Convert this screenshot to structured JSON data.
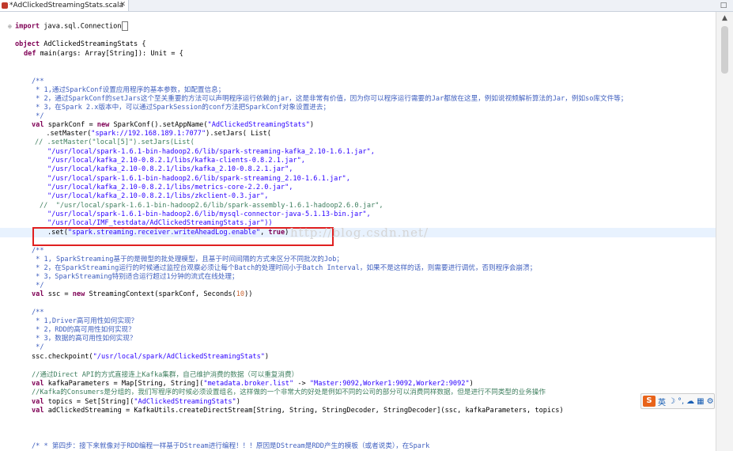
{
  "tab": {
    "title": "*AdClickedStreamingStats.scala",
    "close": "✕"
  },
  "window": {
    "maximize": "□"
  },
  "scrollbar": {
    "up": "▲"
  },
  "watermark": "http://blog.csdn.net/",
  "ime": {
    "logo": "S",
    "lang": "英",
    "icons": [
      "☽",
      "°,",
      "☁",
      "▦",
      "⚙"
    ]
  },
  "code": {
    "import_kw": "import",
    "import_rest": " java.sql.Connection",
    "object_kw": "object",
    "object_rest": " AdClickedStreamingStats {",
    "def_kw": "def",
    "def_rest": " main(args: Array[String]): Unit = {",
    "c1_open": "/**",
    "c1_l1": " * 1,通过SparkConf设置应用程序的基本参数，如配置信息；",
    "c1_l2": " * 2，通过SparkConf的setJars这个至关重要的方法可以声明程序运行依赖的jar，这是非常有价值，因为你可以程序运行需要的Jar都放在这里，例如说视频解析算法的Jar，例如so库文件等；",
    "c1_l3": " * 3，在Spark 2.x版本中，可以通过SparkSession的conf方法把SparkConf对象设置进去；",
    "c1_close": " */",
    "val_kw": "val",
    "new_kw": "new",
    "sc_pre": " sparkConf = ",
    "sc_mid": " SparkConf().setAppName(",
    "sc_app": "\"AdClickedStreamingStats\"",
    "sc_end": ")",
    "sm_pre": "  .setMaster(",
    "sm_url": "\"spark://192.168.189.1:7077\"",
    "sm_end": ").setJars( List(",
    "lc_local": "// .setMaster(\"local[5]\").setJars(List(",
    "jar1": "\"/usr/local/spark-1.6.1-bin-hadoop2.6/lib/spark-streaming-kafka_2.10-1.6.1.jar\",",
    "jar2": "\"/usr/local/kafka_2.10-0.8.2.1/libs/kafka-clients-0.8.2.1.jar\",",
    "jar3": "\"/usr/local/kafka_2.10-0.8.2.1/libs/kafka_2.10-0.8.2.1.jar\",",
    "jar4": "\"/usr/local/spark-1.6.1-bin-hadoop2.6/lib/spark-streaming_2.10-1.6.1.jar\",",
    "jar5": "\"/usr/local/kafka_2.10-0.8.2.1/libs/metrics-core-2.2.0.jar\",",
    "jar6": "\"/usr/local/kafka_2.10-0.8.2.1/libs/zkclient-0.3.jar\",",
    "lc_assembly": "//  \"/usr/local/spark-1.6.1-bin-hadoop2.6/lib/spark-assembly-1.6.1-hadoop2.6.0.jar\",",
    "jar7": "\"/usr/local/spark-1.6.1-bin-hadoop2.6/lib/mysql-connector-java-5.1.13-bin.jar\",",
    "jar8": "\"/usr/local/IMF_testdata/AdClickedStreamingStats.jar\"))",
    "set_pre": ".set(",
    "set_key": "\"spark.streaming.receiver.writeAheadLog.enable\"",
    "set_mid": ", ",
    "true_kw": "true",
    "set_end": ")",
    "c2_open": "/**",
    "c2_l1": " * 1, SparkStreaming基于的是微型的批处理模型，且基于时间间隔的方式来区分不同批次的Job；",
    "c2_l2": " * 2，在SparkStreaming运行的时候通过监控台观察必须让每个Batch的处理时间小于Batch Interval，如果不是这样的话，则需要进行调优，否则程序会崩溃；",
    "c2_l3": " * 3，SparkStreaming特别适合运行超过1分钟的流式在线处理；",
    "c2_close": " */",
    "ssc_pre": " ssc = ",
    "ssc_mid": " StreamingContext(sparkConf, Seconds(",
    "ssc_num": "10",
    "ssc_end": "))",
    "c3_open": "/**",
    "c3_l1": " * 1,Driver高可用性如何实现？",
    "c3_l2": " * 2，RDD的高可用性如何实现？",
    "c3_l3": " * 3，数据的高可用性如何实现？",
    "c3_close": " */",
    "ckpt_pre": "ssc.checkpoint(",
    "ckpt_path": "\"/usr/local/spark/AdClickedStreamingStats\"",
    "ckpt_end": ")",
    "lc_direct": "//通过Direct API的方式直接连上Kafka集群，自己维护消费的数据（可以重复消费）",
    "kp_pre": " kafkaParameters = Map[String, String](",
    "kp_key": "\"metadata.broker.list\"",
    "kp_mid": " -> ",
    "kp_val": "\"Master:9092,Worker1:9092,Worker2:9092\"",
    "kp_end": ")",
    "lc_consumers": "//Kafka的Consumers是分组的，我们写程序的时候必须设置组名，这样做的一个非常大的好处是例如不同的公司的部分可以消费同样数据，但是进行不同类型的业务操作",
    "topics_pre": " topics = Set[String](",
    "topics_val": "\"AdClickedStreamingStats\"",
    "topics_end": ")",
    "stream_rest": " adClickedStreaming = KafkaUtils.createDirectStream[String, String, StringDecoder, StringDecoder](ssc, kafkaParameters, topics)",
    "c4": "/* * 第四步：接下来就像对于RDD编程一样基于DStream进行编程！！！原因是DStream是RDD产生的模板（或者说类），在Spark"
  }
}
